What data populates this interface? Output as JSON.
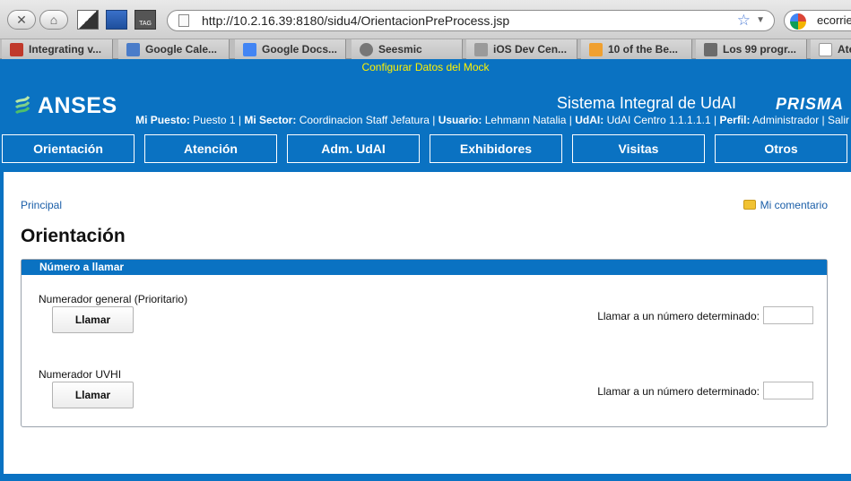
{
  "browser": {
    "url": "http://10.2.16.39:8180/sidu4/OrientacionPreProcess.jsp",
    "search_value": "ecorrie",
    "tabs": [
      {
        "label": "Integrating v...",
        "color": "#c0392b"
      },
      {
        "label": "Google Cale...",
        "color": "#4a7cc9"
      },
      {
        "label": "Google Docs...",
        "color": "#4285f4"
      },
      {
        "label": "Seesmic",
        "color": "#777777"
      },
      {
        "label": "iOS Dev Cen...",
        "color": "#9a9a9a"
      },
      {
        "label": "10 of the Be...",
        "color": "#f0a030"
      },
      {
        "label": "Los 99 progr...",
        "color": "#6b6b6b"
      },
      {
        "label": "Ate",
        "color": "#ffffff"
      }
    ]
  },
  "app": {
    "mock_link": "Configurar Datos del Mock",
    "logo_text": "ANSES",
    "system_title": "Sistema Integral de UdAI",
    "prisma_logo": "PRISMA",
    "user_info": {
      "puesto_label": "Mi Puesto:",
      "puesto": "Puesto 1",
      "sector_label": "Mi Sector:",
      "sector": "Coordinacion Staff Jefatura",
      "usuario_label": "Usuario:",
      "usuario": "Lehmann Natalia",
      "udai_label": "UdAI:",
      "udai": "UdAI Centro 1.1.1.1.1",
      "perfil_label": "Perfil:",
      "perfil": "Administrador",
      "salir": "Salir"
    },
    "nav": [
      "Orientación",
      "Atención",
      "Adm. UdAI",
      "Exhibidores",
      "Visitas",
      "Otros"
    ],
    "breadcrumb": "Principal",
    "comment_link": "Mi comentario",
    "page_title": "Orientación",
    "panel": {
      "title": "Número a llamar",
      "rows": [
        {
          "label": "Numerador general (Prioritario)",
          "button": "Llamar",
          "number_label": "Llamar a un número determinado:",
          "number_value": ""
        },
        {
          "label": "Numerador UVHI",
          "button": "Llamar",
          "number_label": "Llamar a un número determinado:",
          "number_value": ""
        }
      ]
    },
    "colors": {
      "brand_blue": "#0a72c2",
      "mock_yellow": "#fff200"
    }
  }
}
